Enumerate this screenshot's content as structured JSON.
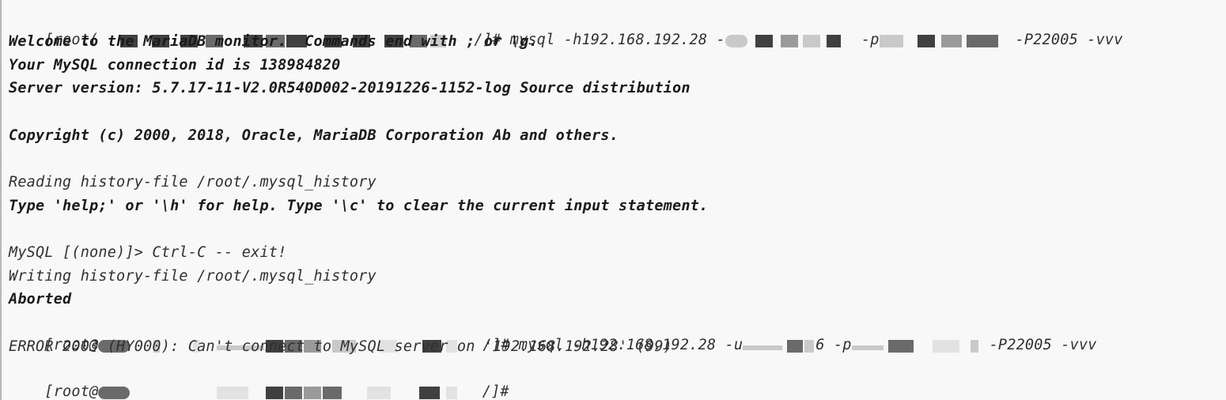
{
  "terminal": {
    "partial_top_line": "...   ...  ...  ...",
    "lines": [
      {
        "prefix": "[root(",
        "suffix": "/]# mysql -h192.168.192.28 -",
        "end": "-P22005 -vvv",
        "mid": "-p"
      },
      {
        "text": "Welcome to the MariaDB monitor.  Commands end with ; or \\g."
      },
      {
        "text": "Your MySQL connection id is 138984820"
      },
      {
        "text": "Server version: 5.7.17-11-V2.0R540D002-20191226-1152-log Source distribution"
      },
      {
        "text": ""
      },
      {
        "text": "Copyright (c) 2000, 2018, Oracle, MariaDB Corporation Ab and others."
      },
      {
        "text": ""
      },
      {
        "text": "Reading history-file /root/.mysql_history"
      },
      {
        "text": "Type 'help;' or '\\h' for help. Type '\\c' to clear the current input statement."
      },
      {
        "text": ""
      },
      {
        "text": "MySQL [(none)]> Ctrl-C -- exit!"
      },
      {
        "text": "Writing history-file /root/.mysql_history"
      },
      {
        "text": "Aborted"
      },
      {
        "prefix": "[root@",
        "suffix": "/]# mysql -h192.168.192.28 -u",
        "mid": "6 -p",
        "end": "-P22005 -vvv"
      },
      {
        "text": "ERROR 2003 (HY000): Can't connect to MySQL server on '192.168.192.28' (99)"
      },
      {
        "prefix": "[root@",
        "suffix": " /]#"
      }
    ]
  }
}
